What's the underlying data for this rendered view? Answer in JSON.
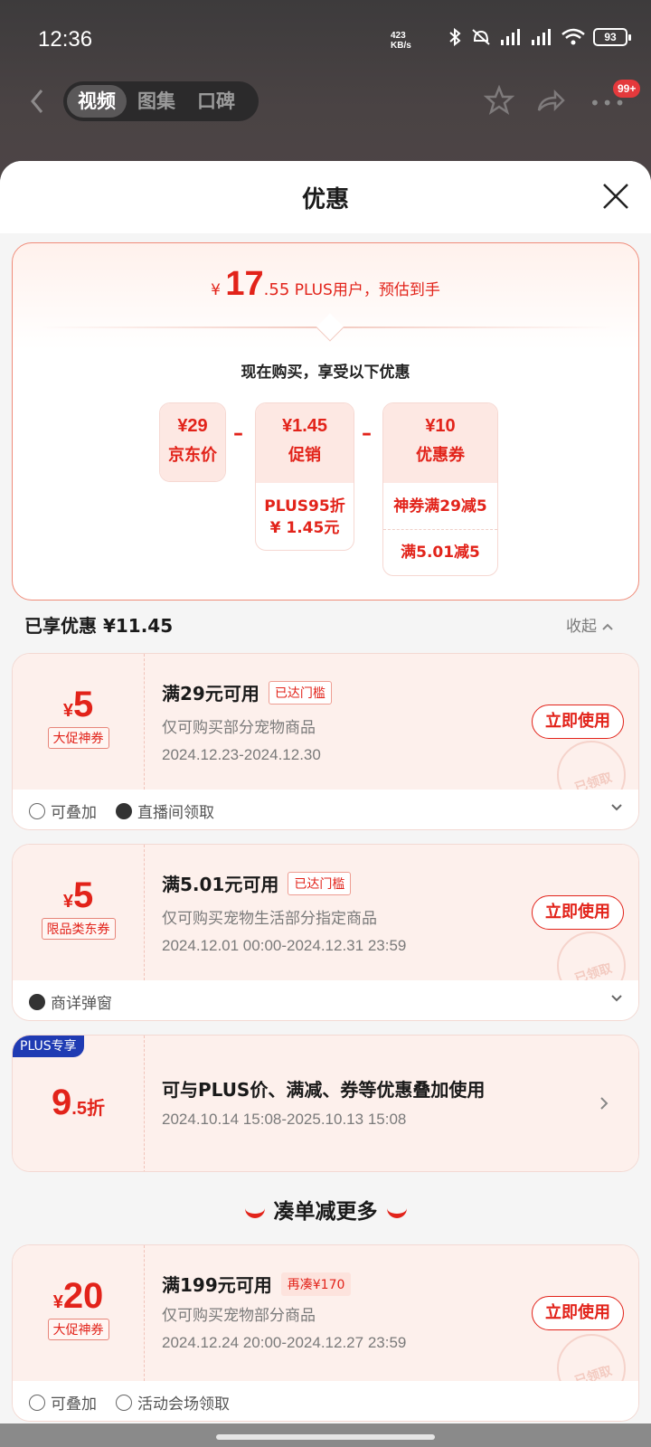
{
  "status": {
    "time": "12:36",
    "net_speed_top": "423",
    "net_speed_unit": "KB/s",
    "battery": "93"
  },
  "topbar": {
    "tabs": [
      {
        "label": "视频",
        "active": true
      },
      {
        "label": "图集"
      },
      {
        "label": "口碑"
      }
    ],
    "badge": "99+"
  },
  "sheet": {
    "title": "优惠"
  },
  "estimate": {
    "yen": "¥",
    "int": "17",
    "dec": ".55",
    "text": "PLUS用户，预估到手"
  },
  "breakdown": {
    "subhead": "现在购买，享受以下优惠",
    "jd_price": {
      "amount": "¥29",
      "label": "京东价"
    },
    "promo": {
      "amount": "¥1.45",
      "label": "促销",
      "detail_line1": "PLUS95折",
      "detail_line2": "¥ 1.45元"
    },
    "coupon": {
      "amount": "¥10",
      "label": "优惠券",
      "items": [
        "神券满29减5",
        "满5.01减5"
      ]
    }
  },
  "enjoyed": {
    "label": "已享优惠 ¥11.45",
    "collapse": "收起"
  },
  "coupons": [
    {
      "yen": "¥",
      "value": "5",
      "tag": "大促神券",
      "title": "满29元可用",
      "status": "已达门槛",
      "desc": "仅可购买部分宠物商品",
      "date": "2024.12.23-2024.12.30",
      "button": "立即使用",
      "stamp": "已领取",
      "foot": [
        "可叠加",
        "直播间领取"
      ]
    },
    {
      "yen": "¥",
      "value": "5",
      "tag": "限品类东券",
      "title": "满5.01元可用",
      "status": "已达门槛",
      "desc": "仅可购买宠物生活部分指定商品",
      "date": "2024.12.01 00:00-2024.12.31 23:59",
      "button": "立即使用",
      "stamp": "已领取",
      "foot": [
        "商详弹窗"
      ]
    }
  ],
  "plus": {
    "badge": "PLUS专享",
    "value_int": "9",
    "value_dec": ".5折",
    "title": "可与PLUS价、满减、券等优惠叠加使用",
    "date": "2024.10.14 15:08-2025.10.13 15:08"
  },
  "more": {
    "heading": "凑单减更多",
    "coupon": {
      "yen": "¥",
      "value": "20",
      "tag": "大促神券",
      "title": "满199元可用",
      "status": "再凑¥170",
      "desc": "仅可购买宠物部分商品",
      "date": "2024.12.24 20:00-2024.12.27 23:59",
      "button": "立即使用",
      "stamp": "已领取",
      "foot": [
        "可叠加",
        "活动会场领取"
      ]
    }
  }
}
